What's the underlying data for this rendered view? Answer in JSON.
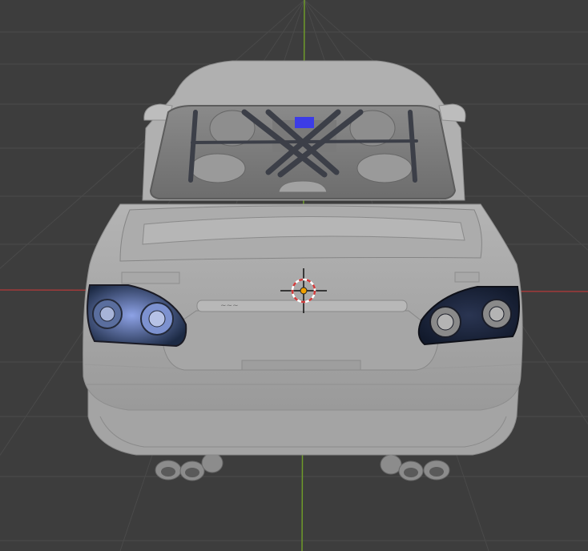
{
  "viewport": {
    "background": "#3d3d3d",
    "grid_color": "#4a4a4a",
    "x_axis_color": "#a13a3a",
    "y_axis_color": "#6e9a2a",
    "view": "3d-viewport-back-view"
  },
  "model": {
    "object": "car-sedan-rear",
    "body_color": "#a9a9a9",
    "taillight_color": "#1c2a44",
    "taillight_glow_color": "#6f86d6",
    "selected_face_color": "#3c3ce6",
    "trunk_badge": "~~~"
  },
  "cursor_3d": {
    "ring_color": "#d23c3c",
    "center_color": "#f0a000",
    "icon": "3d-cursor-icon"
  }
}
